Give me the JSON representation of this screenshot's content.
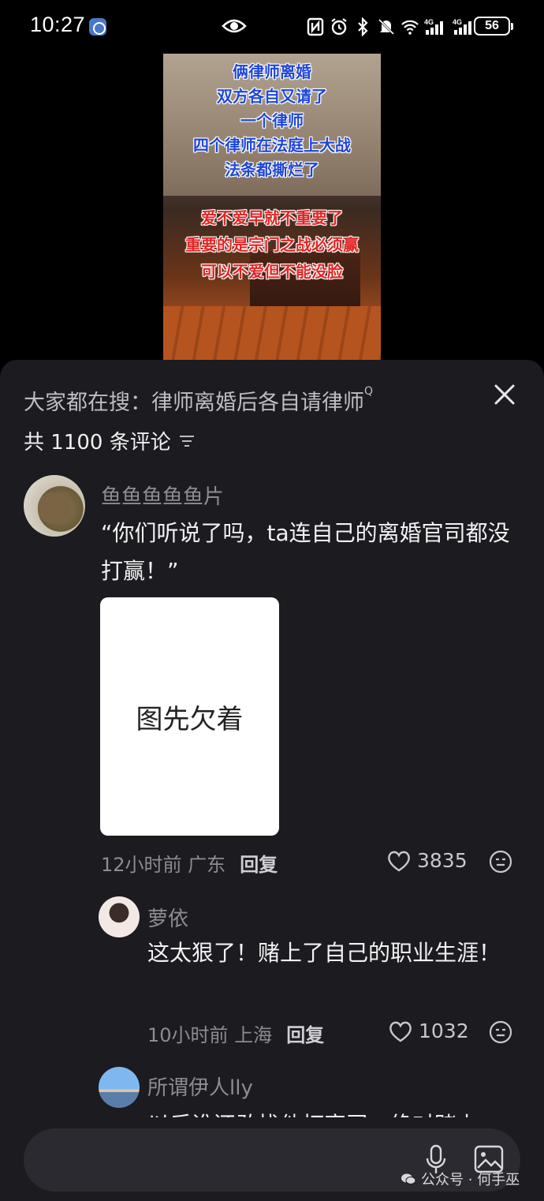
{
  "status_bar": {
    "time": "10:27",
    "battery": "56",
    "icons": [
      "app-notification-icon",
      "eye-icon",
      "nfc-icon",
      "alarm-icon",
      "bluetooth-icon",
      "mute-icon",
      "wifi-icon",
      "signal-4g-icon",
      "signal-4g-icon"
    ]
  },
  "video": {
    "caption_blue": [
      "俩律师离婚",
      "双方各自又请了",
      "一个律师",
      "四个律师在法庭上大战",
      "法条都撕烂了"
    ],
    "caption_red": [
      "爱不爱早就不重要了",
      "重要的是宗门之战必须赢",
      "可以不爱但不能没脸"
    ]
  },
  "comments_panel": {
    "hot_search_prefix": "大家都在搜：",
    "hot_search_term": "律师离婚后各自请律师",
    "hot_search_mark": "Q",
    "count_label": "共 1100 条评论",
    "comments": [
      {
        "user": "鱼鱼鱼鱼鱼片",
        "text": "“你们听说了吗，ta连自己的离婚官司都没打赢！”",
        "image_text": "图先欠着",
        "time": "12小时前",
        "location": "广东",
        "reply_label": "回复",
        "likes": "3835"
      },
      {
        "user": "萝依",
        "text": "这太狠了！赌上了自己的职业生涯！",
        "time": "10小时前",
        "location": "上海",
        "reply_label": "回复",
        "likes": "1032"
      },
      {
        "user": "所谓伊人lly",
        "text": "以后谁还敢找他打官司，绝对赌上"
      }
    ]
  },
  "watermark": {
    "text": "公众号 · 何手巫"
  },
  "colors": {
    "sheet_bg": "#1b1b20",
    "caption_blue": "#1e46d8",
    "caption_red": "#e02626"
  }
}
